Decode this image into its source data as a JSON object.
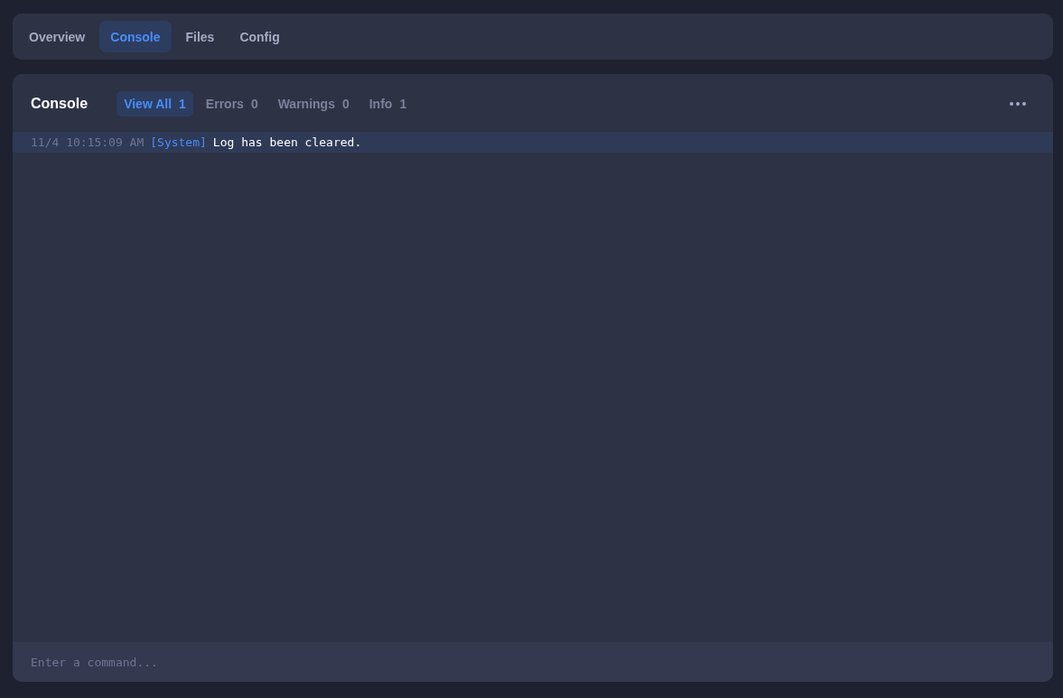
{
  "tabs": [
    {
      "label": "Overview",
      "selected": false
    },
    {
      "label": "Console",
      "selected": true
    },
    {
      "label": "Files",
      "selected": false
    },
    {
      "label": "Config",
      "selected": false
    }
  ],
  "console": {
    "title": "Console",
    "filters": [
      {
        "label": "View All",
        "count": "1",
        "selected": true
      },
      {
        "label": "Errors",
        "count": "0",
        "selected": false
      },
      {
        "label": "Warnings",
        "count": "0",
        "selected": false
      },
      {
        "label": "Info",
        "count": "1",
        "selected": false
      }
    ],
    "log": [
      {
        "time": "11/4 10:15:09 AM",
        "source": "[System]",
        "message": "Log has been cleared.",
        "selected": true
      }
    ],
    "command": {
      "placeholder": "Enter a command..."
    }
  }
}
